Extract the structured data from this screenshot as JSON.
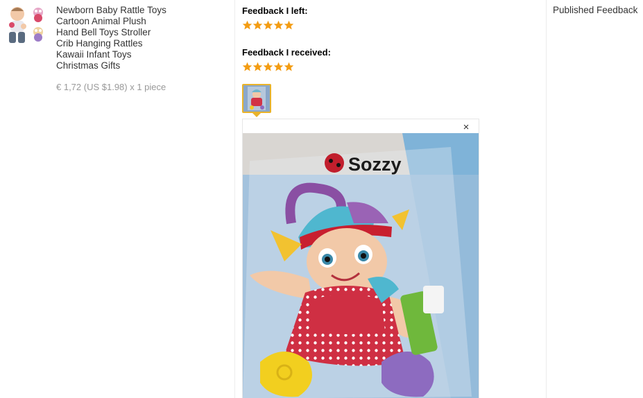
{
  "product": {
    "title_lines": [
      "Newborn Baby Rattle Toys",
      "Cartoon Animal Plush",
      "Hand Bell Toys Stroller",
      "Crib Hanging Rattles",
      "Kawaii Infant Toys",
      "Christmas Gifts"
    ],
    "price": "€ 1,72 (US $1.98) x 1 piece"
  },
  "feedback": {
    "left_label": "Feedback I left:",
    "left_rating": 5,
    "received_label": "Feedback I received:",
    "received_rating": 5,
    "star_color": "#f39c12"
  },
  "photo": {
    "brand_text": "Sozzy",
    "close_symbol": "×",
    "close_icon": "close-icon"
  },
  "actions": {
    "published_label": "Published Feedback"
  }
}
